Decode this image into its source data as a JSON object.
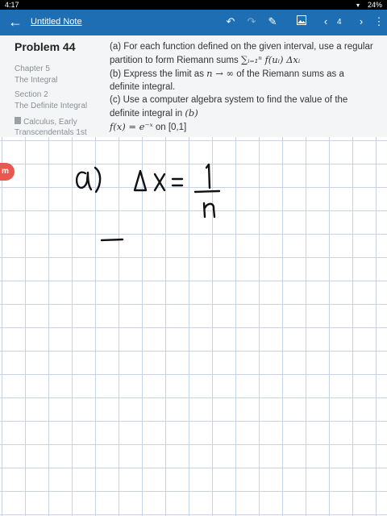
{
  "status": {
    "time": "4:17",
    "battery": "24%"
  },
  "appbar": {
    "title": "Untitled Note",
    "page_number": "4",
    "icons": [
      "back-arrow-icon",
      "undo-icon",
      "redo-icon",
      "pencil-icon",
      "image-icon",
      "prev-page-icon",
      "next-page-icon",
      "more-icon"
    ]
  },
  "problem": {
    "title": "Problem 44",
    "chapter": "Chapter 5",
    "chapter_name": "The Integral",
    "section": "Section 2",
    "section_name": "The Definite Integral",
    "book": "Calculus, Early Transcendentals 1st",
    "part_a": "(a) For each function defined on the given interval, use a regular partition to form Riemann sums",
    "part_a_math": "∑ᵢ₌₁ⁿ f(uᵢ) Δxᵢ",
    "part_b_pre": "(b) Express the limit as",
    "part_b_math": "n → ∞",
    "part_b_post": "of the Riemann sums as a definite integral.",
    "part_c": "(c) Use a computer algebra system to find the value of the definite integral in",
    "part_c_ref": "(b)",
    "function_math": "f(x) = e⁻ˣ",
    "function_interval": "on [0,1]"
  },
  "badge_text": "m",
  "colors": {
    "appbar": "#1e6eb3",
    "panel": "#f4f5f6",
    "grid": "#c6d4e8",
    "badge": "#e8584f"
  }
}
